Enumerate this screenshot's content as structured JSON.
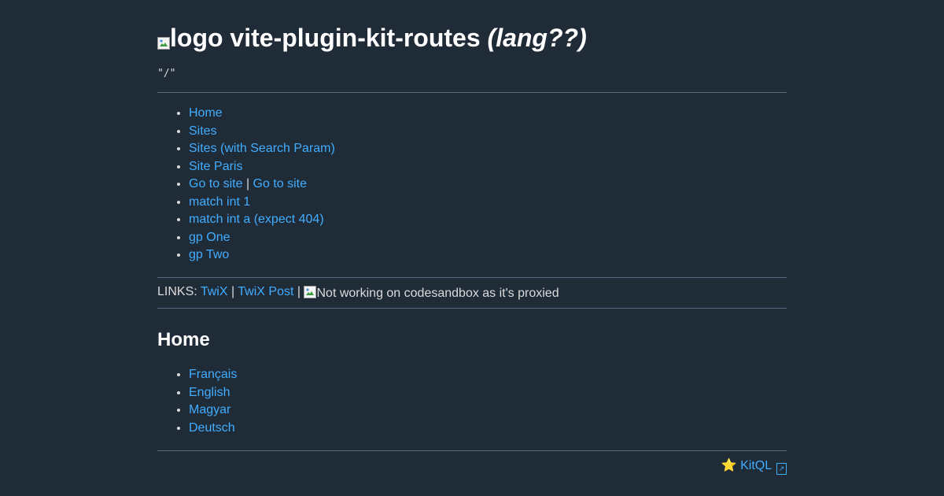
{
  "header": {
    "logo_alt": "logo",
    "app_name": "vite-plugin-kit-routes",
    "lang_label": "(lang??)",
    "current_route": "\"/\""
  },
  "nav": {
    "items": [
      {
        "label": "Home"
      },
      {
        "label": "Sites"
      },
      {
        "label": "Sites (with Search Param)"
      },
      {
        "label": "Site Paris"
      },
      {
        "label": "Go to site",
        "separator": "|",
        "label2": "Go to site"
      },
      {
        "label": "match int 1"
      },
      {
        "label": "match int a (expect 404)"
      },
      {
        "label": "gp One"
      },
      {
        "label": "gp Two"
      }
    ]
  },
  "links": {
    "prefix": "LINKS:",
    "twix": "TwiX",
    "sep1": "|",
    "twix_post": "TwiX Post",
    "sep2": "|",
    "proxied_alt": "Not working on codesandbox as it's proxied"
  },
  "home": {
    "title": "Home",
    "languages": [
      {
        "label": "Français"
      },
      {
        "label": "English"
      },
      {
        "label": "Magyar"
      },
      {
        "label": "Deutsch"
      }
    ]
  },
  "footer": {
    "kitql_label": "⭐ KitQL",
    "external_icon": "external-link-icon"
  },
  "colors": {
    "background": "#202b38",
    "link": "#41adff",
    "text": "#dbdbdb",
    "heading": "#ffffff",
    "divider": "#526980"
  }
}
